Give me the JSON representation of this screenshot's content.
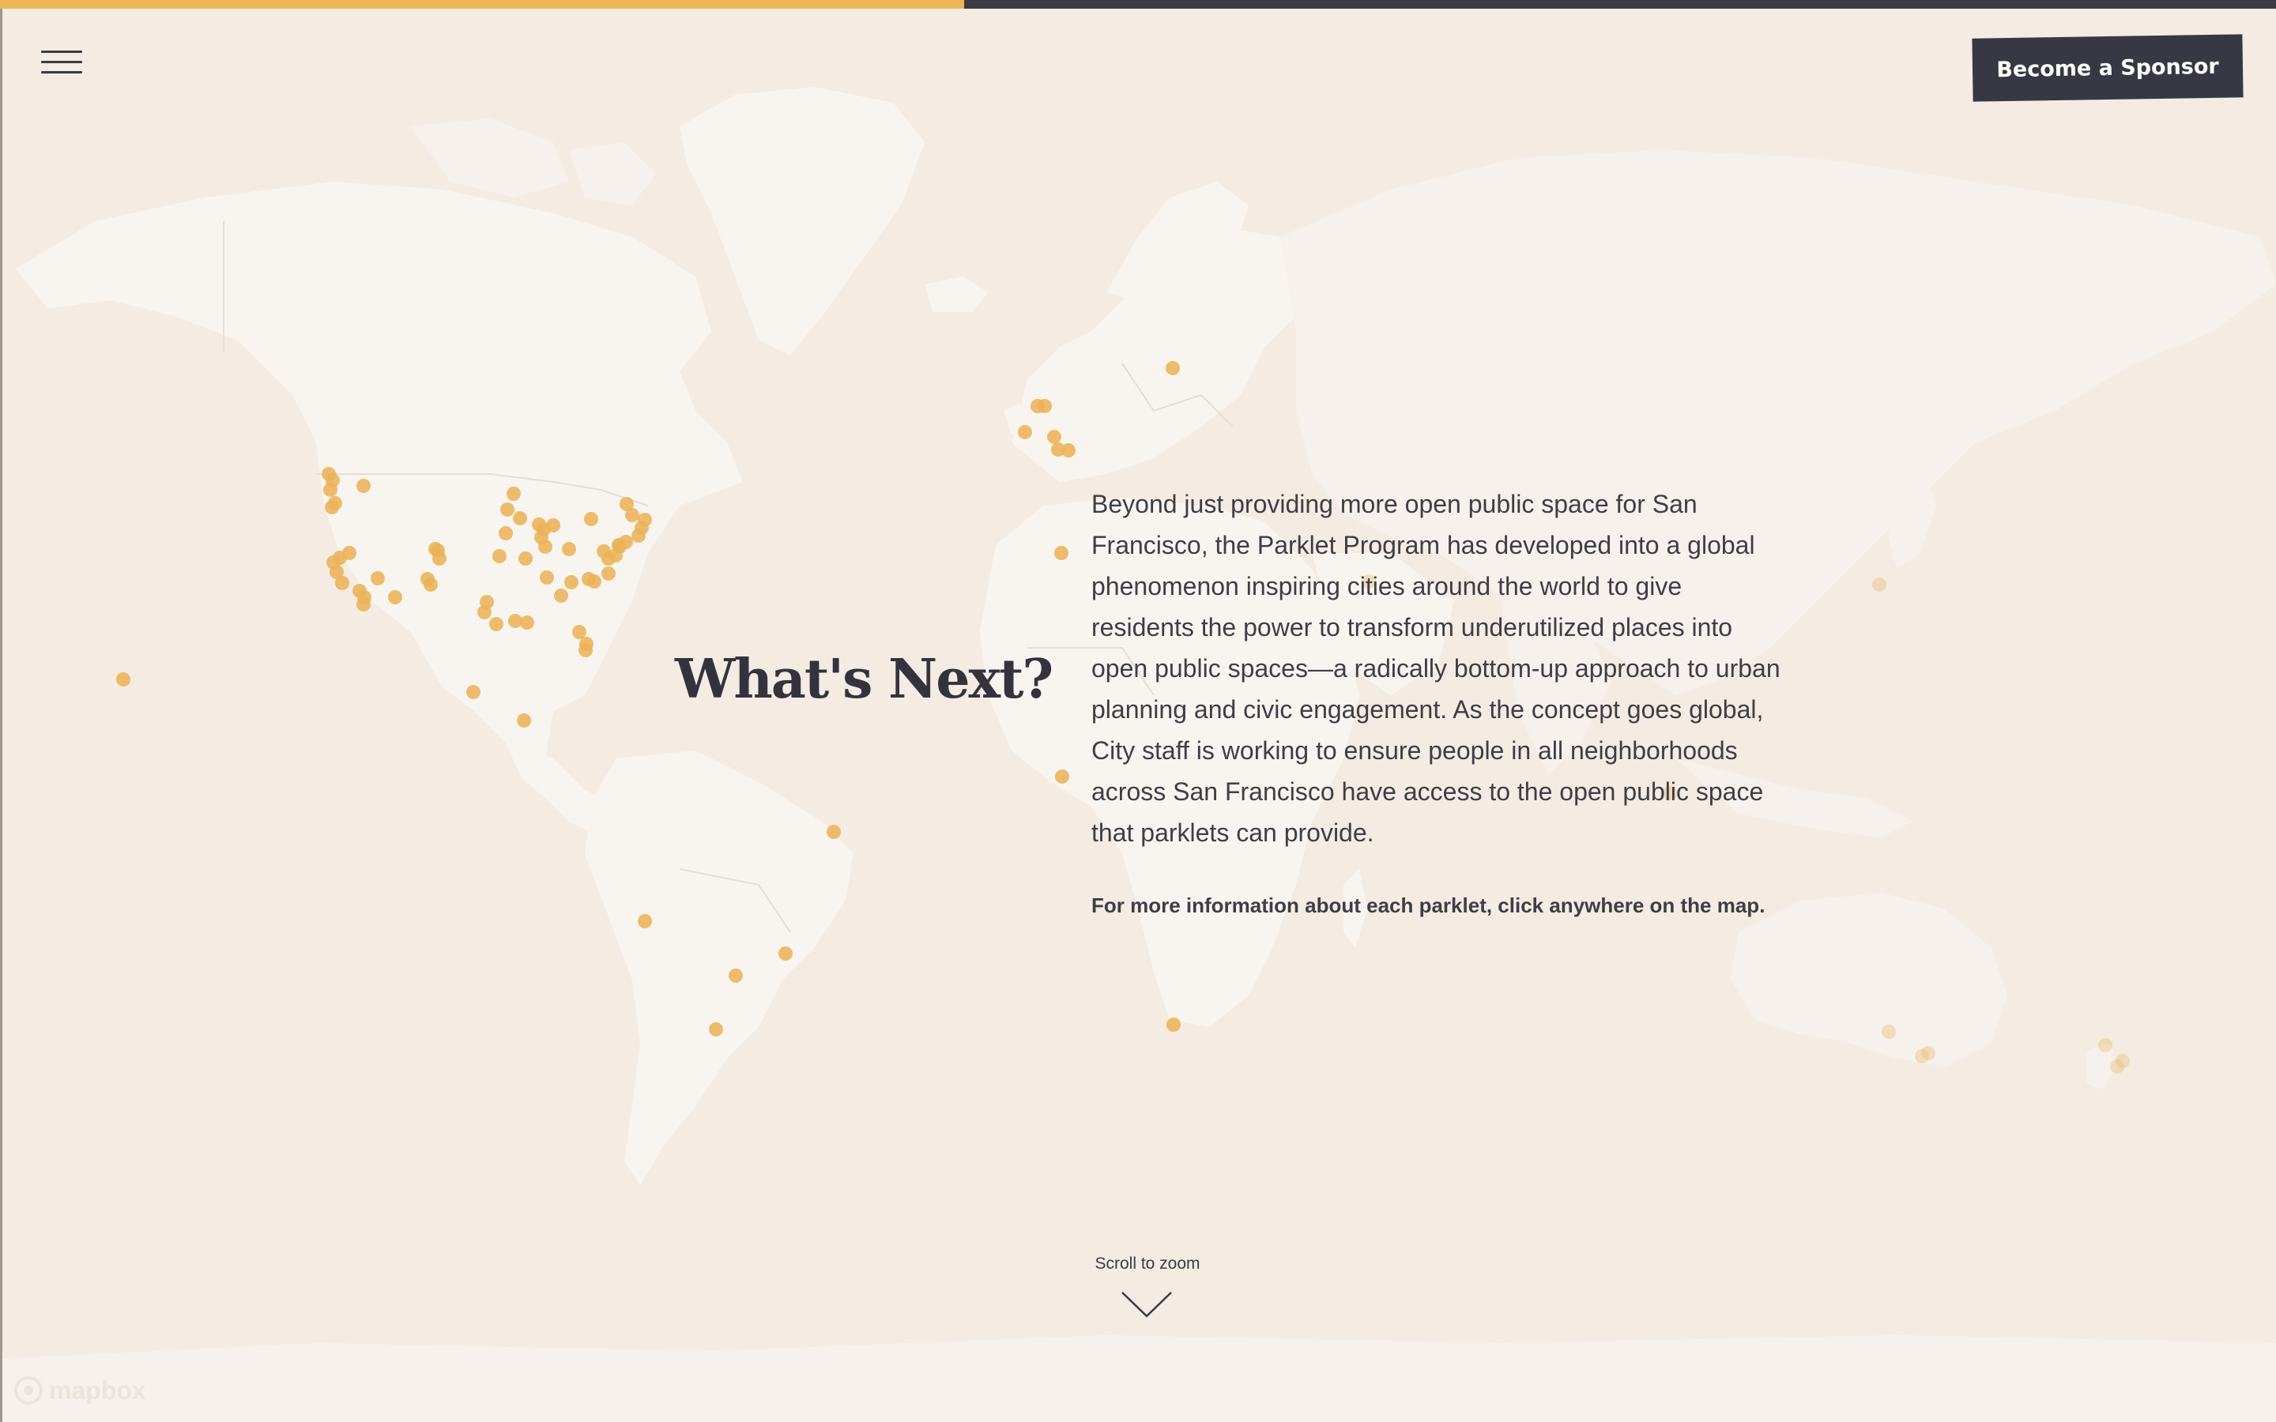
{
  "header": {
    "progress": 0.4236,
    "menu_icon": "hamburger-menu-icon",
    "sponsor_label": "Become a Sponsor"
  },
  "main": {
    "heading": "What's Next?",
    "body": "Beyond just providing more open public space for San Francisco, the Parklet Program has developed into a global phenomenon inspiring cities around the world to give residents the power to transform underutilized places into open public spaces—a radically bottom-up approach to urban planning and civic engagement. As the concept goes global, City staff is working to ensure people in all neighborhoods across San Francisco have access to the open public space that parklets can provide.",
    "note": "For more information about each parklet, click anywhere on the map."
  },
  "scroll_hint": {
    "label": "Scroll to zoom",
    "icon": "chevron-down-icon"
  },
  "map": {
    "attribution": "mapbox",
    "logo_icon": "mapbox-logo-icon",
    "colors": {
      "ocean": "#f4ece3",
      "land": "#f8f5f1",
      "marker": "#eab358",
      "text": "#34333d",
      "accent": "#ecb656",
      "dark": "#383844"
    }
  }
}
